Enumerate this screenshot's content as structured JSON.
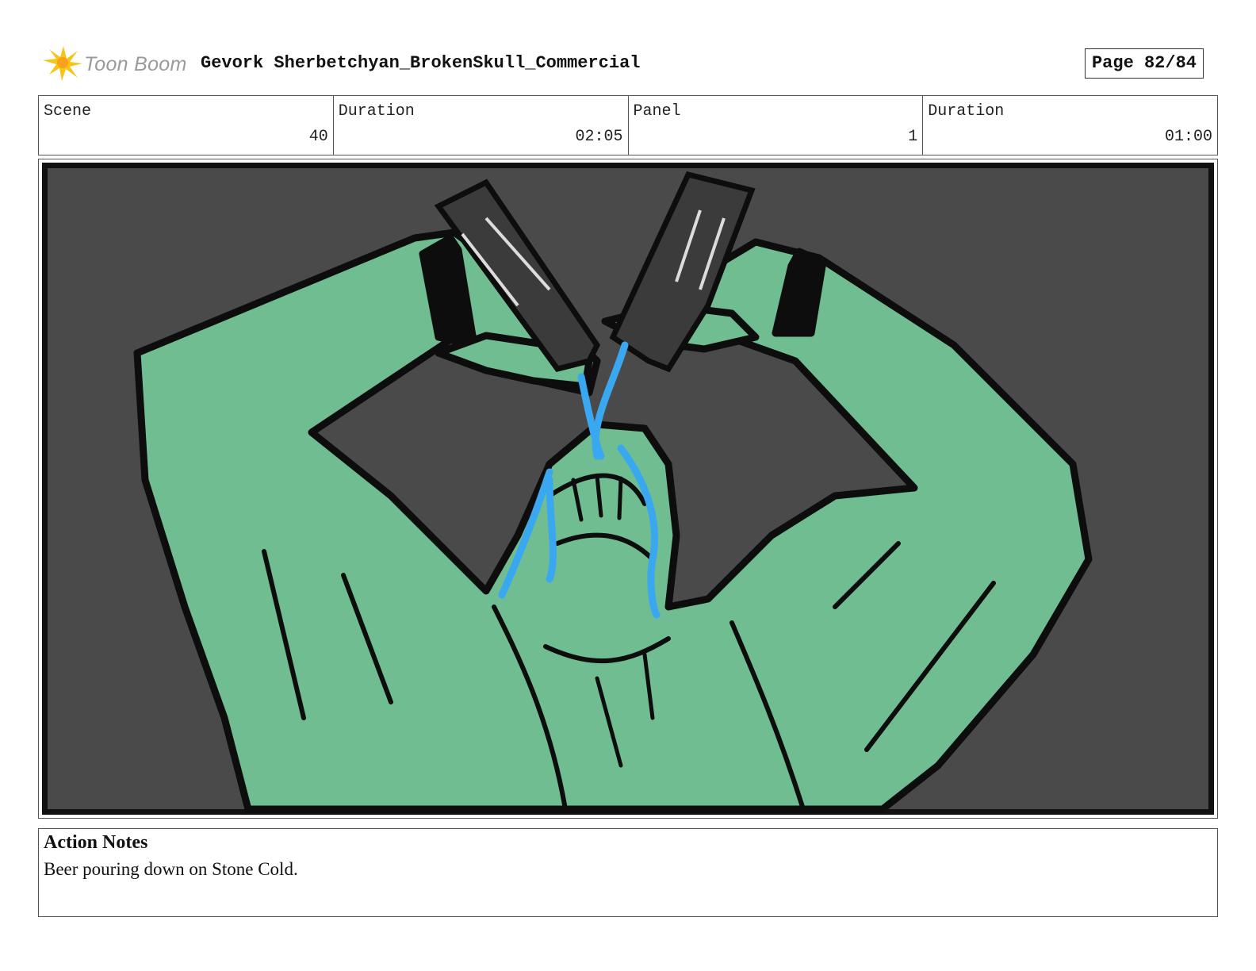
{
  "header": {
    "logo_text": "Toon Boom",
    "title": "Gevork Sherbetchyan_BrokenSkull_Commercial",
    "page_label": "Page 82/84"
  },
  "info": [
    {
      "label": "Scene",
      "value": "40"
    },
    {
      "label": "Duration",
      "value": "02:05"
    },
    {
      "label": "Panel",
      "value": "1"
    },
    {
      "label": "Duration",
      "value": "01:00"
    }
  ],
  "panel": {
    "background_color": "#4a4a4a",
    "figure_color": "#6fbd91",
    "liquid_color": "#3aa8f0",
    "can_color": "#3b3b3b"
  },
  "notes": {
    "title": "Action Notes",
    "text": "Beer pouring down on Stone Cold."
  }
}
